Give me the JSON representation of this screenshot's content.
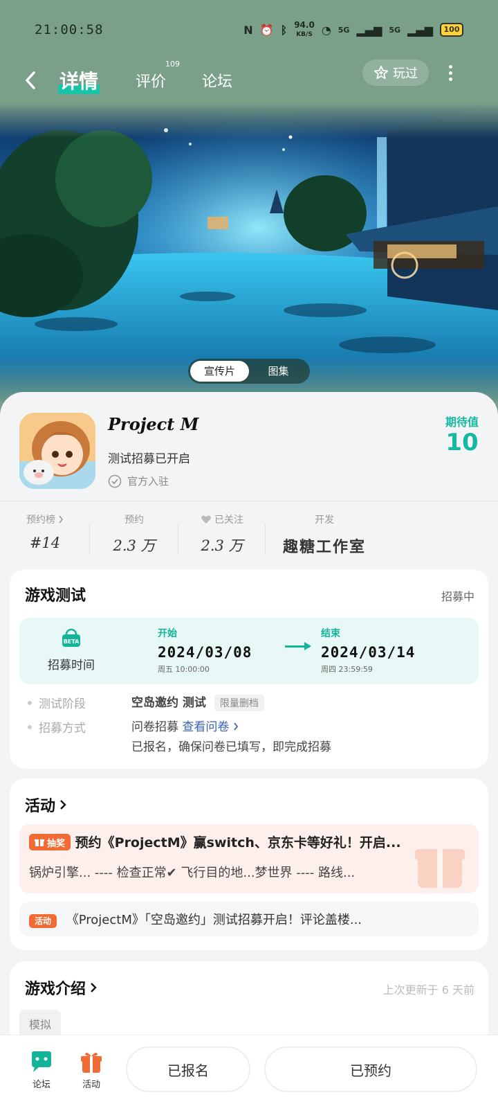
{
  "status": {
    "time": "21:00:58",
    "net_speed": "94.0",
    "net_unit": "KB/S",
    "signal1": "5G",
    "signal2": "5G",
    "battery": "100"
  },
  "nav": {
    "tabs": [
      {
        "label": "详情",
        "active": true
      },
      {
        "label": "评价",
        "badge": "109"
      },
      {
        "label": "论坛"
      }
    ],
    "played_label": "玩过"
  },
  "banner": {
    "segments": [
      "宣传片",
      "图集"
    ]
  },
  "app": {
    "title": "Project M",
    "subtitle": "测试招募已开启",
    "official": "官方入驻",
    "expect_label": "期待值",
    "expect_value": "10"
  },
  "stats": [
    {
      "label": "预约榜",
      "value": "#14"
    },
    {
      "label": "预约",
      "value": "2.3 万"
    },
    {
      "label": "已关注",
      "value": "2.3 万"
    },
    {
      "label": "开发",
      "value": "趣糖工作室"
    }
  ],
  "test": {
    "title": "游戏测试",
    "status": "招募中",
    "beta_tag": "BETA",
    "time_label": "招募时间",
    "start_label": "开始",
    "start_date": "2024/03/08",
    "start_time": "周五  10:00:00",
    "end_label": "结束",
    "end_date": "2024/03/14",
    "end_time": "周四  23:59:59",
    "stage_label": "测试阶段",
    "stage_value": "空岛邀约 测试",
    "stage_tag": "限量删档",
    "method_label": "招募方式",
    "method_value": "问卷招募",
    "method_link": "查看问卷",
    "method_note": "已报名，确保问卷已填写，即完成招募"
  },
  "activity": {
    "title": "活动",
    "lottery_badge": "抽奖",
    "lottery_title": "预约《ProjectM》赢switch、京东卡等好礼！开启...",
    "lottery_desc": "锅炉引擎... ---- 检查正常✔ 飞行目的地...梦世界 ---- 路线...",
    "event_badge": "活动",
    "event_title": "《ProjectM》「空岛邀约」测试招募开启！评论盖楼..."
  },
  "intro": {
    "title": "游戏介绍",
    "updated": "上次更新于 6 天前",
    "tag": "模拟"
  },
  "bottom": {
    "forum": "论坛",
    "activity": "活动",
    "registered": "已报名",
    "reserved": "已预约"
  }
}
